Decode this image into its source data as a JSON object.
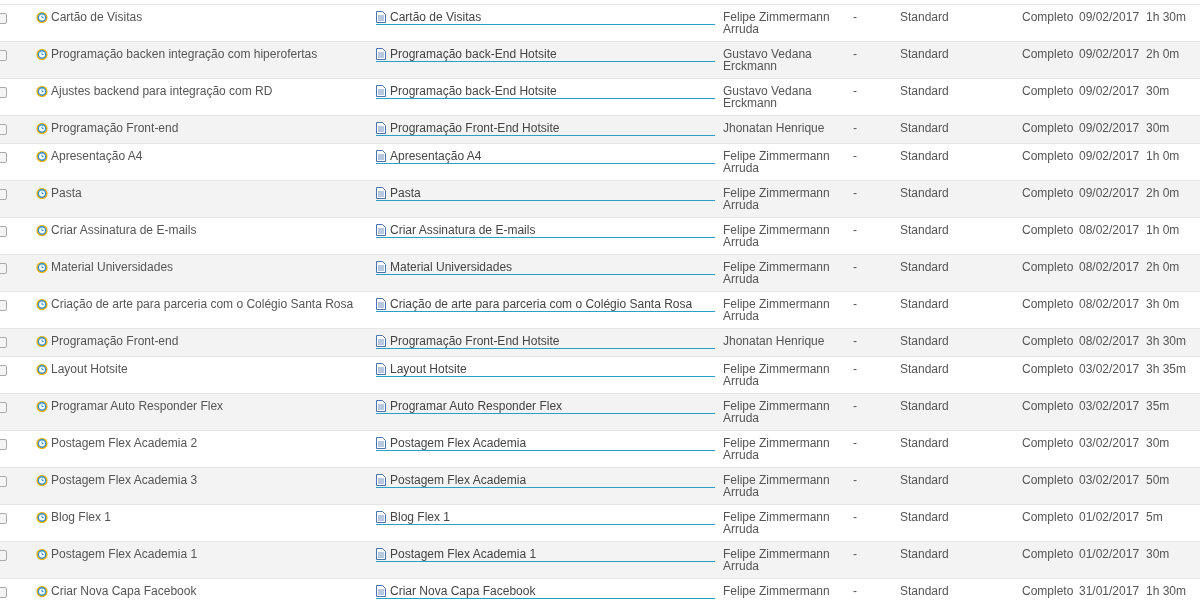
{
  "rows": [
    {
      "checked": false,
      "name": "Cartão de Visitas",
      "link": "Cartão de Visitas",
      "owner": "Felipe Zimmermann Arruda",
      "dash": "-",
      "type": "Standard",
      "status": "Completo",
      "date": "09/02/2017",
      "duration": "1h 30m"
    },
    {
      "checked": false,
      "name": "Programação backen integração com hiperofertas",
      "link": "Programação back-End Hotsite",
      "owner": "Gustavo Vedana Erckmann",
      "dash": "-",
      "type": "Standard",
      "status": "Completo",
      "date": "09/02/2017",
      "duration": "2h 0m"
    },
    {
      "checked": false,
      "name": "Ajustes backend para integração com RD",
      "link": "Programação back-End Hotsite",
      "owner": "Gustavo Vedana Erckmann",
      "dash": "-",
      "type": "Standard",
      "status": "Completo",
      "date": "09/02/2017",
      "duration": "30m"
    },
    {
      "checked": false,
      "name": "Programação Front-end",
      "link": "Programação Front-End Hotsite",
      "owner": "Jhonatan Henrique",
      "dash": "-",
      "type": "Standard",
      "status": "Completo",
      "date": "09/02/2017",
      "duration": "30m"
    },
    {
      "checked": false,
      "name": "Apresentação A4",
      "link": "Apresentação A4",
      "owner": "Felipe Zimmermann Arruda",
      "dash": "-",
      "type": "Standard",
      "status": "Completo",
      "date": "09/02/2017",
      "duration": "1h 0m"
    },
    {
      "checked": false,
      "name": "Pasta",
      "link": "Pasta",
      "owner": "Felipe Zimmermann Arruda",
      "dash": "-",
      "type": "Standard",
      "status": "Completo",
      "date": "09/02/2017",
      "duration": "2h 0m"
    },
    {
      "checked": false,
      "name": "Criar Assinatura de E-mails",
      "link": "Criar Assinatura de E-mails",
      "owner": "Felipe Zimmermann Arruda",
      "dash": "-",
      "type": "Standard",
      "status": "Completo",
      "date": "08/02/2017",
      "duration": "1h 0m"
    },
    {
      "checked": false,
      "name": "Material Universidades",
      "link": "Material Universidades",
      "owner": "Felipe Zimmermann Arruda",
      "dash": "-",
      "type": "Standard",
      "status": "Completo",
      "date": "08/02/2017",
      "duration": "2h 0m"
    },
    {
      "checked": false,
      "name": "Criação de arte para parceria com o Colégio Santa Rosa",
      "link": "Criação de arte para parceria com o Colégio Santa Rosa",
      "owner": "Felipe Zimmermann Arruda",
      "dash": "-",
      "type": "Standard",
      "status": "Completo",
      "date": "08/02/2017",
      "duration": "3h 0m"
    },
    {
      "checked": false,
      "name": "Programação Front-end",
      "link": "Programação Front-End Hotsite",
      "owner": "Jhonatan Henrique",
      "dash": "-",
      "type": "Standard",
      "status": "Completo",
      "date": "08/02/2017",
      "duration": "3h 30m"
    },
    {
      "checked": false,
      "name": "Layout Hotsite",
      "link": "Layout Hotsite",
      "owner": "Felipe Zimmermann Arruda",
      "dash": "-",
      "type": "Standard",
      "status": "Completo",
      "date": "03/02/2017",
      "duration": "3h 35m"
    },
    {
      "checked": false,
      "name": "Programar Auto Responder Flex",
      "link": "Programar Auto Responder Flex",
      "owner": "Felipe Zimmermann Arruda",
      "dash": "-",
      "type": "Standard",
      "status": "Completo",
      "date": "03/02/2017",
      "duration": "35m"
    },
    {
      "checked": false,
      "name": "Postagem Flex Academia 2",
      "link": "Postagem Flex Academia",
      "owner": "Felipe Zimmermann Arruda",
      "dash": "-",
      "type": "Standard",
      "status": "Completo",
      "date": "03/02/2017",
      "duration": "30m"
    },
    {
      "checked": false,
      "name": "Postagem Flex Academia 3",
      "link": "Postagem Flex Academia",
      "owner": "Felipe Zimmermann Arruda",
      "dash": "-",
      "type": "Standard",
      "status": "Completo",
      "date": "03/02/2017",
      "duration": "50m"
    },
    {
      "checked": false,
      "name": "Blog Flex 1",
      "link": "Blog Flex 1",
      "owner": "Felipe Zimmermann Arruda",
      "dash": "-",
      "type": "Standard",
      "status": "Completo",
      "date": "01/02/2017",
      "duration": "5m"
    },
    {
      "checked": false,
      "name": "Postagem Flex Academia 1",
      "link": "Postagem Flex Academia 1",
      "owner": "Felipe Zimmermann Arruda",
      "dash": "-",
      "type": "Standard",
      "status": "Completo",
      "date": "01/02/2017",
      "duration": "30m"
    },
    {
      "checked": false,
      "name": "Criar Nova Capa Facebook",
      "link": "Criar Nova Capa Facebook",
      "owner": "Felipe Zimmermann",
      "dash": "-",
      "type": "Standard",
      "status": "Completo",
      "date": "31/01/2017",
      "duration": "1h 30m"
    }
  ]
}
